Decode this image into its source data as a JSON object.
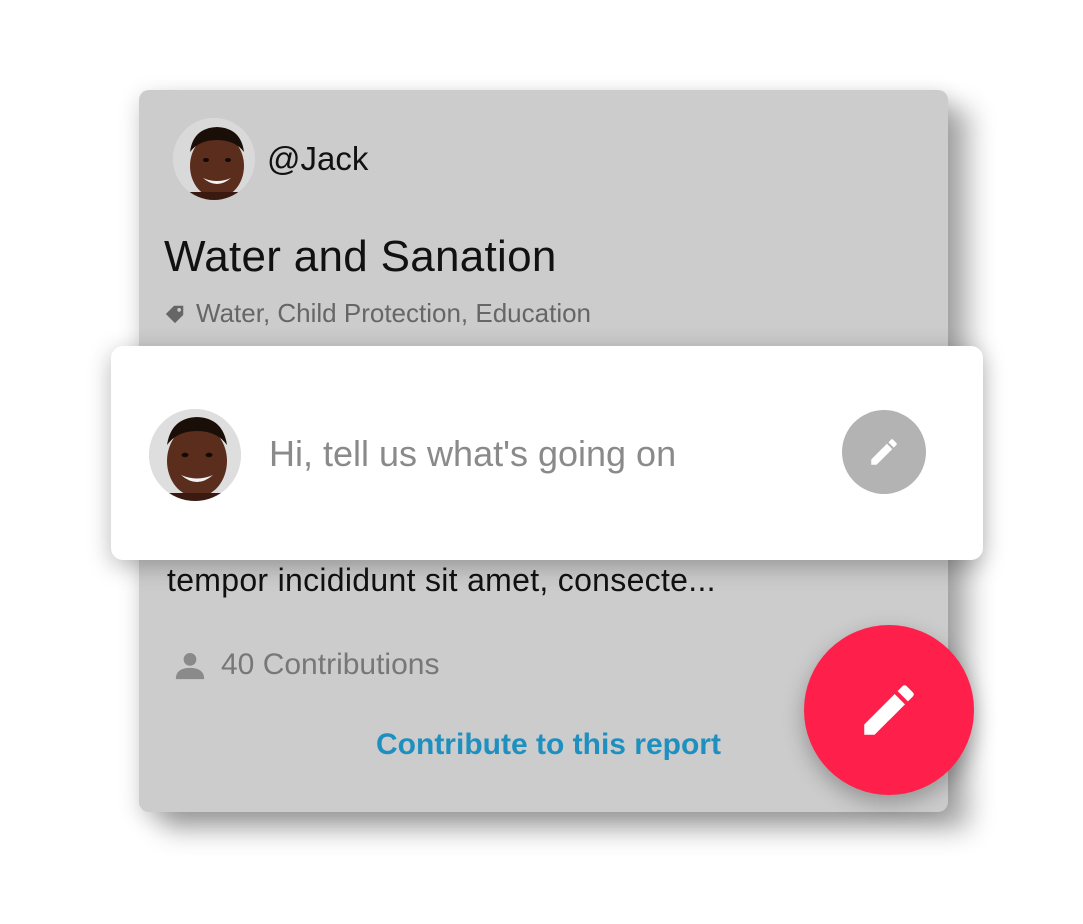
{
  "report": {
    "author": "@Jack",
    "title": "Water and Sanation",
    "tags": "Water, Child Protection, Education",
    "excerpt": "tempor incididunt sit amet, consecte...",
    "contributions": "40 Contributions",
    "cta_label": "Contribute to this report"
  },
  "compose": {
    "placeholder": "Hi, tell us what's going on"
  },
  "icons": {
    "tag": "tag-icon",
    "person": "person-icon",
    "compose_edit": "pencil-icon",
    "fab": "pencil-icon"
  },
  "colors": {
    "card_bg": "#cccccc",
    "cta": "#1e90c0",
    "fab": "#ff1f4b",
    "edit_button": "#b3b3b3"
  }
}
